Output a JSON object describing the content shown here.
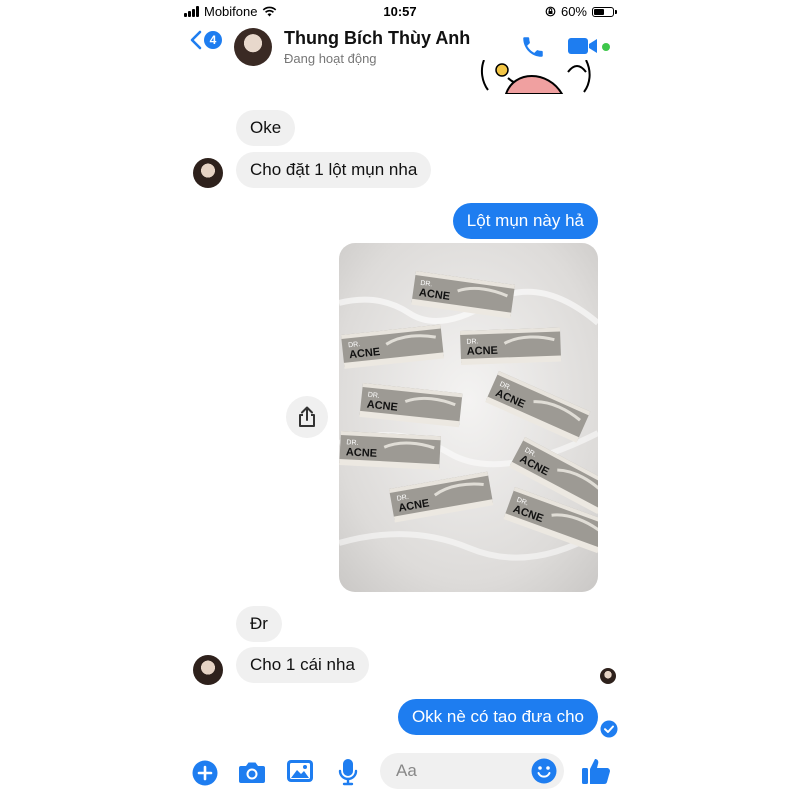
{
  "status_bar": {
    "carrier": "Mobifone",
    "time": "10:57",
    "battery": "60%",
    "battery_level": 0.6
  },
  "header": {
    "back_count": "4",
    "contact_name": "Thung Bích Thùy Anh",
    "contact_status": "Đang hoạt động"
  },
  "messages": {
    "m1": "Oke",
    "m2": "Cho đặt 1 lột mụn nha",
    "m3": "Lột mụn này hả",
    "m4": "Đr",
    "m5": "Cho 1 cái nha",
    "m6": "Okk nè có tao đưa cho"
  },
  "photo": {
    "box_brand_top": "DR.",
    "box_brand": "ACNE"
  },
  "composer": {
    "placeholder": "Aa"
  },
  "colors": {
    "accent": "#1e7df0",
    "incoming_bubble": "#f0f0f0",
    "online": "#3ec74b"
  }
}
